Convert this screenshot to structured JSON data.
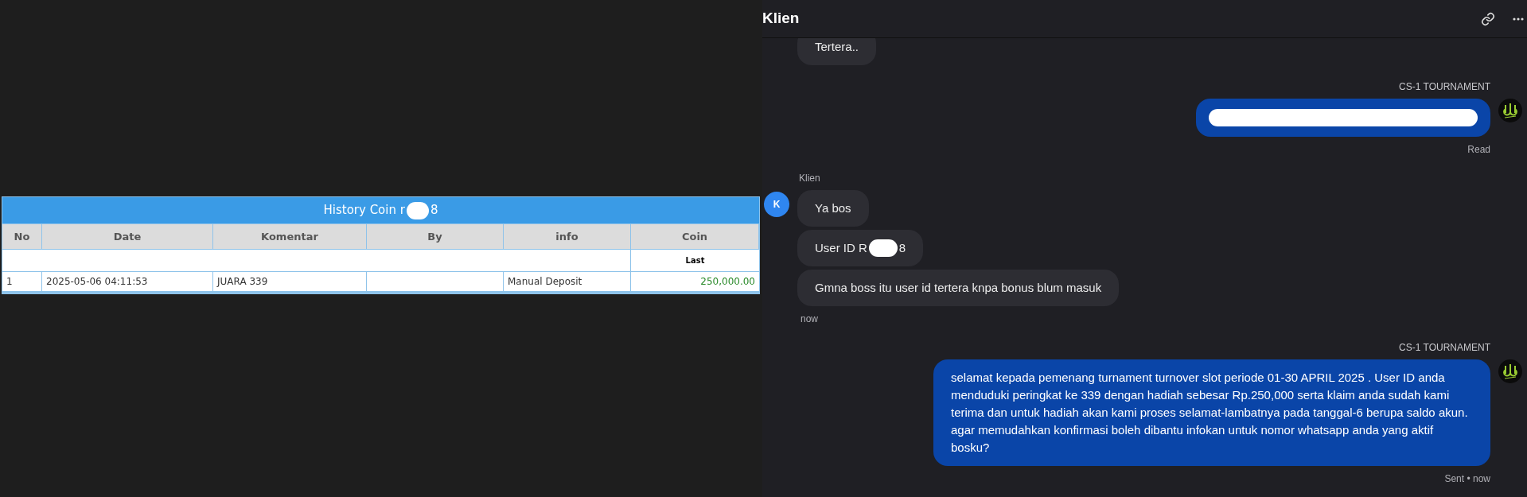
{
  "coin_history": {
    "title_before": "History Coin r",
    "title_after": "8",
    "columns": [
      "No",
      "Date",
      "Komentar",
      "By",
      "info",
      "Coin"
    ],
    "subheader": "Last",
    "rows": [
      {
        "no": "1",
        "date": "2025-05-06 04:11:53",
        "komentar": "JUARA 339",
        "by": "",
        "info": "Manual Deposit",
        "coin": "250,000.00"
      }
    ]
  },
  "chat": {
    "title": "Klien",
    "groups": [
      {
        "kind": "incoming",
        "bubbles": [
          {
            "kind": "text",
            "text": "Tertera.."
          }
        ]
      },
      {
        "kind": "outgoing",
        "sender": "CS-1 TOURNAMENT",
        "bubbles": [
          {
            "kind": "redacted"
          }
        ],
        "status": "Read"
      },
      {
        "kind": "incoming",
        "sender": "Klien",
        "avatar": "K",
        "bubbles": [
          {
            "kind": "text",
            "text": "Ya bos"
          },
          {
            "kind": "redacted_text",
            "before": "User ID R",
            "after": "8"
          },
          {
            "kind": "text",
            "text": "Gmna boss itu user id tertera knpa bonus blum masuk"
          }
        ],
        "status": "now"
      },
      {
        "kind": "outgoing",
        "sender": "CS-1 TOURNAMENT",
        "bubbles": [
          {
            "kind": "text",
            "text": "selamat kepada pemenang turnament turnover slot periode 01-30 APRIL 2025 . User ID anda menduduki peringkat ke 339 dengan hadiah sebesar Rp.250,000 serta klaim anda sudah kami terima dan untuk hadiah akan kami proses selamat-lambatnya pada tanggal-6 berupa saldo akun. agar memudahkan konfirmasi boleh dibantu infokan untuk nomor whatsapp anda yang aktif bosku?"
          }
        ],
        "status": "Sent • now"
      }
    ]
  }
}
